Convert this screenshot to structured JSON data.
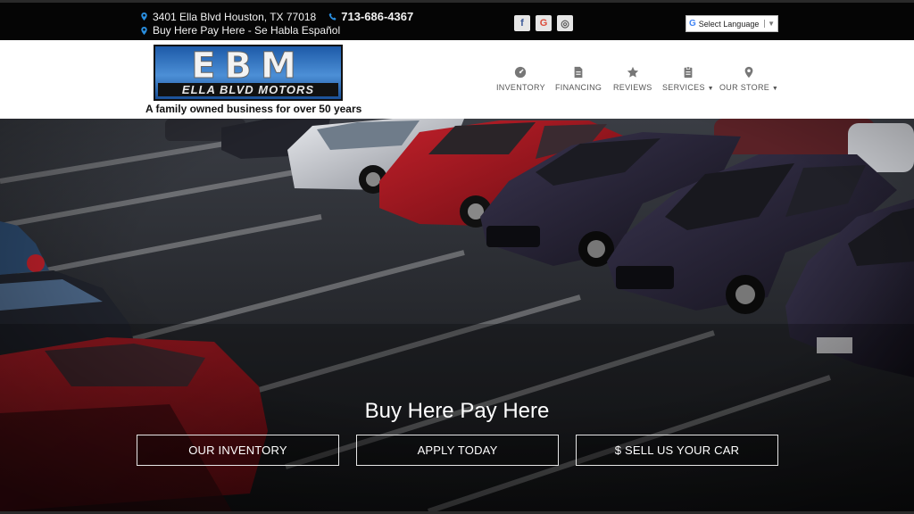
{
  "topbar": {
    "address": "3401 Ella Blvd Houston, TX 77018",
    "phone": "713-686-4367",
    "tagline": "Buy Here Pay Here - Se Habla Español",
    "social": [
      "f",
      "G",
      "◎"
    ],
    "language_label": "Select Language"
  },
  "header": {
    "logo_big": "EBM",
    "logo_sub": "ELLA BLVD MOTORS",
    "tagline": "A family owned business for over 50 years"
  },
  "nav": [
    {
      "label": "INVENTORY",
      "icon": "dashboard-icon"
    },
    {
      "label": "FINANCING",
      "icon": "document-icon"
    },
    {
      "label": "REVIEWS",
      "icon": "star-icon"
    },
    {
      "label": "SERVICES",
      "icon": "clipboard-icon"
    },
    {
      "label": "OUR STORE",
      "icon": "map-pin-icon"
    }
  ],
  "hero": {
    "title": "Buy Here Pay Here",
    "buttons": [
      "OUR INVENTORY",
      "APPLY TODAY",
      "$ SELL US YOUR CAR"
    ]
  }
}
